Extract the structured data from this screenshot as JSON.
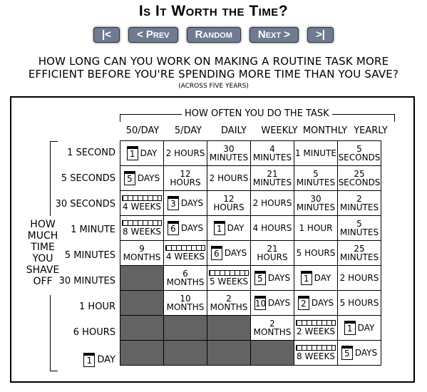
{
  "title": "Is It Worth the Time?",
  "nav": [
    "|<",
    "< Prev",
    "Random",
    "Next >",
    ">|"
  ],
  "subtitle_line1": "HOW LONG CAN YOU WORK ON MAKING A ROUTINE TASK MORE",
  "subtitle_line2": "EFFICIENT BEFORE YOU'RE SPENDING MORE TIME THAN YOU SAVE?",
  "note": "(ACROSS FIVE YEARS)",
  "column_caption": "HOW OFTEN YOU DO THE TASK",
  "columns": [
    "50/DAY",
    "5/DAY",
    "DAILY",
    "WEEKLY",
    "MONTHLY",
    "YEARLY"
  ],
  "side_label": [
    "HOW",
    "MUCH",
    "TIME",
    "YOU",
    "SHAVE",
    "OFF"
  ],
  "rows": [
    {
      "label": "1 SECOND",
      "cells": [
        {
          "icon": "1",
          "text": "DAY"
        },
        {
          "text": "2 HOURS"
        },
        {
          "text": "30 MINUTES"
        },
        {
          "text": "4 MINUTES"
        },
        {
          "text": "1 MINUTE"
        },
        {
          "text": "5 SECONDS"
        }
      ]
    },
    {
      "label": "5 SECONDS",
      "cells": [
        {
          "icon": "5",
          "text": "DAYS"
        },
        {
          "text": "12 HOURS"
        },
        {
          "text": "2 HOURS"
        },
        {
          "text": "21 MINUTES"
        },
        {
          "text": "5 MINUTES"
        },
        {
          "text": "25 SECONDS"
        }
      ]
    },
    {
      "label": "30 SECONDS",
      "cells": [
        {
          "strip": true,
          "text": "4 WEEKS"
        },
        {
          "icon": "3",
          "text": "DAYS"
        },
        {
          "text": "12 HOURS"
        },
        {
          "text": "2 HOURS"
        },
        {
          "text": "30 MINUTES"
        },
        {
          "text": "2 MINUTES"
        }
      ]
    },
    {
      "label": "1 MINUTE",
      "cells": [
        {
          "strip": true,
          "text": "8 WEEKS"
        },
        {
          "icon": "6",
          "text": "DAYS"
        },
        {
          "icon": "1",
          "text": "DAY"
        },
        {
          "text": "4 HOURS"
        },
        {
          "text": "1 HOUR"
        },
        {
          "text": "5 MINUTES"
        }
      ]
    },
    {
      "label": "5 MINUTES",
      "cells": [
        {
          "text": "9 MONTHS"
        },
        {
          "strip": true,
          "text": "4 WEEKS"
        },
        {
          "icon": "6",
          "text": "DAYS"
        },
        {
          "text": "21 HOURS"
        },
        {
          "text": "5 HOURS"
        },
        {
          "text": "25 MINUTES"
        }
      ]
    },
    {
      "label": "30 MINUTES",
      "cells": [
        {
          "shade": true
        },
        {
          "text": "6 MONTHS"
        },
        {
          "strip": true,
          "text": "5 WEEKS"
        },
        {
          "icon": "5",
          "text": "DAYS"
        },
        {
          "icon": "1",
          "text": "DAY"
        },
        {
          "text": "2 HOURS"
        }
      ]
    },
    {
      "label": "1 HOUR",
      "cells": [
        {
          "shade": true
        },
        {
          "text": "10 MONTHS"
        },
        {
          "text": "2 MONTHS"
        },
        {
          "icon": "10",
          "text": "DAYS"
        },
        {
          "icon": "2",
          "text": "DAYS"
        },
        {
          "text": "5 HOURS"
        }
      ]
    },
    {
      "label": "6 HOURS",
      "cells": [
        {
          "shade": true
        },
        {
          "shade": true
        },
        {
          "shade": true
        },
        {
          "text": "2 MONTHS"
        },
        {
          "strip": true,
          "text": "2 WEEKS"
        },
        {
          "icon": "1",
          "text": "DAY"
        }
      ]
    },
    {
      "label_icon": "1",
      "label": "DAY",
      "cells": [
        {
          "shade": true
        },
        {
          "shade": true
        },
        {
          "shade": true
        },
        {
          "shade": true
        },
        {
          "strip": true,
          "text": "8 WEEKS"
        },
        {
          "icon": "5",
          "text": "DAYS"
        }
      ]
    }
  ]
}
